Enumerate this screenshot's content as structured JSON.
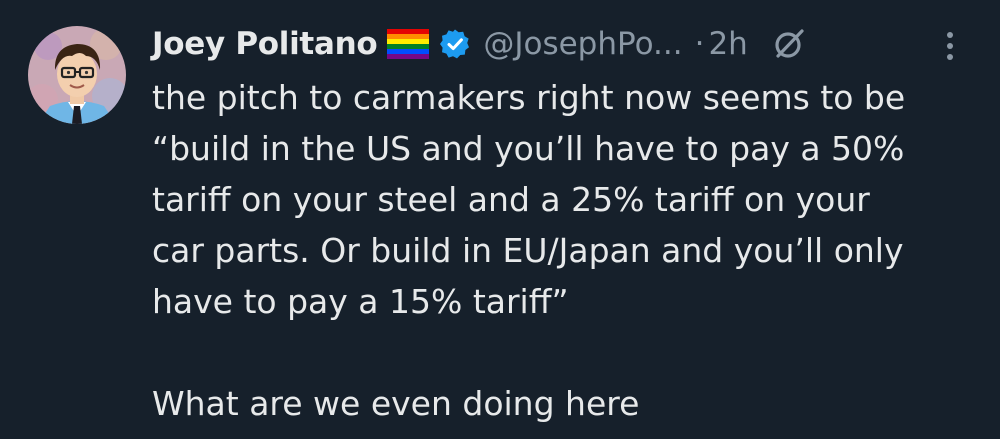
{
  "tweet": {
    "author": {
      "display_name": "Joey Politano",
      "handle": "@JosephPo...",
      "flag_icon": "rainbow-flag-icon",
      "verified_icon": "verified-badge-icon",
      "verified_color": "#1d9bf0"
    },
    "separator": "·",
    "time": "2h",
    "grok_icon": "grok-icon",
    "more_icon": "more-options-icon",
    "text": "the pitch to carmakers right now seems to be\n“build in the US and you’ll have to pay a 50%\ntariff on your steel and a 25% tariff on your\ncar parts. Or build in EU/Japan and you’ll only\nhave to pay a 15% tariff”\n\nWhat are we even doing here"
  },
  "colors": {
    "background": "#16202b",
    "primary_text": "#e7e9ea",
    "secondary_text": "#8b98a5"
  }
}
